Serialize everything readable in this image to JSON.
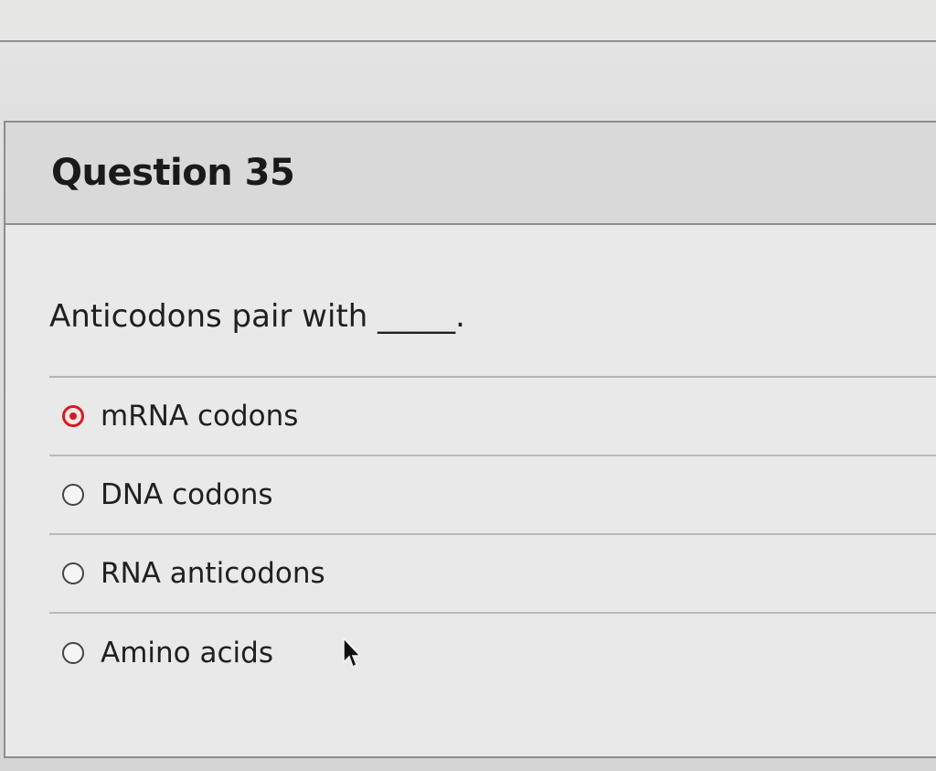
{
  "question": {
    "title": "Question 35",
    "prompt": "Anticodons pair with _____.",
    "answers": [
      {
        "label": "mRNA codons",
        "selected": true
      },
      {
        "label": "DNA codons",
        "selected": false
      },
      {
        "label": "RNA anticodons",
        "selected": false
      },
      {
        "label": "Amino acids",
        "selected": false
      }
    ]
  },
  "colors": {
    "selected": "#d71920",
    "border": "#8d8d8d"
  },
  "icons": {
    "selected_radio": "radio-selected-icon",
    "unselected_radio": "radio-empty-icon",
    "cursor": "mouse-cursor-icon"
  }
}
